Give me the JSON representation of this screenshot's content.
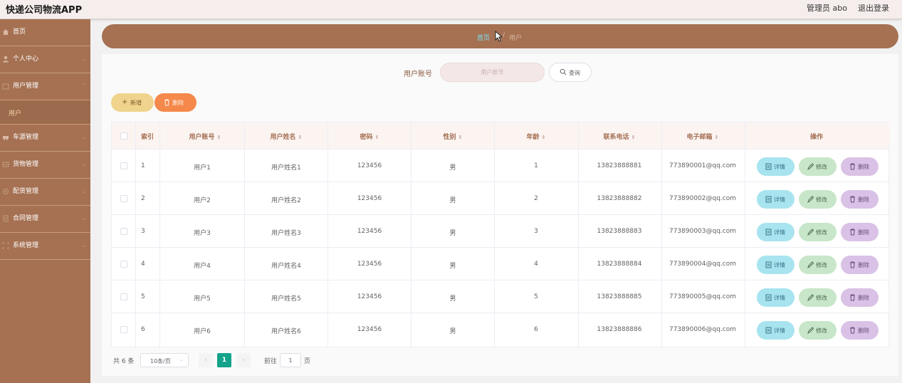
{
  "header": {
    "app_title": "快递公司物流APP",
    "admin": "管理员 abo",
    "logout": "退出登录"
  },
  "sidebar": {
    "items": [
      {
        "label": "首页",
        "icon": "home-icon",
        "has_children": false
      },
      {
        "label": "个人中心",
        "icon": "user-icon",
        "has_children": true
      },
      {
        "label": "用户管理",
        "icon": "folder-icon",
        "has_children": true,
        "children": [
          "用户"
        ]
      },
      {
        "label": "车源管理",
        "icon": "car-icon",
        "has_children": true
      },
      {
        "label": "货物管理",
        "icon": "box-icon",
        "has_children": true
      },
      {
        "label": "配货管理",
        "icon": "settings-icon",
        "has_children": true
      },
      {
        "label": "合同管理",
        "icon": "document-icon",
        "has_children": true
      },
      {
        "label": "系统管理",
        "icon": "system-icon",
        "has_children": true
      }
    ],
    "active_child": "用户"
  },
  "breadcrumb": {
    "home": "首页",
    "current": "用户"
  },
  "search": {
    "label": "用户账号",
    "placeholder": "用户账号",
    "button": "查询"
  },
  "toolbar": {
    "add": "新增",
    "delete": "删除"
  },
  "table": {
    "headers": [
      "索引",
      "用户账号",
      "用户姓名",
      "密码",
      "性别",
      "年龄",
      "联系电话",
      "电子邮箱",
      "操作"
    ],
    "rows": [
      {
        "index": "1",
        "account": "用户1",
        "name": "用户姓名1",
        "password": "123456",
        "gender": "男",
        "age": "1",
        "phone": "13823888881",
        "email": "773890001@qq.com"
      },
      {
        "index": "2",
        "account": "用户2",
        "name": "用户姓名2",
        "password": "123456",
        "gender": "男",
        "age": "2",
        "phone": "13823888882",
        "email": "773890002@qq.com"
      },
      {
        "index": "3",
        "account": "用户3",
        "name": "用户姓名3",
        "password": "123456",
        "gender": "男",
        "age": "3",
        "phone": "13823888883",
        "email": "773890003@qq.com"
      },
      {
        "index": "4",
        "account": "用户4",
        "name": "用户姓名4",
        "password": "123456",
        "gender": "男",
        "age": "4",
        "phone": "13823888884",
        "email": "773890004@qq.com"
      },
      {
        "index": "5",
        "account": "用户5",
        "name": "用户姓名5",
        "password": "123456",
        "gender": "男",
        "age": "5",
        "phone": "13823888885",
        "email": "773890005@qq.com"
      },
      {
        "index": "6",
        "account": "用户6",
        "name": "用户姓名6",
        "password": "123456",
        "gender": "男",
        "age": "6",
        "phone": "13823888886",
        "email": "773890006@qq.com"
      }
    ],
    "actions": {
      "detail": "详情",
      "edit": "修改",
      "delete": "删除"
    }
  },
  "pagination": {
    "total": "共 6 条",
    "page_size": "10条/页",
    "current_page": "1",
    "goto_label": "前往",
    "goto_value": "1",
    "page_suffix": "页"
  },
  "colors": {
    "sidebar": "#a57152",
    "accent": "#13a38b",
    "header_bg": "#f6eeed",
    "add_button": "#f0d38c",
    "delete_button": "#f5884b",
    "detail_button": "#a8e4ef",
    "edit_button": "#c8e6c9",
    "row_delete_button": "#d9c2e6"
  }
}
